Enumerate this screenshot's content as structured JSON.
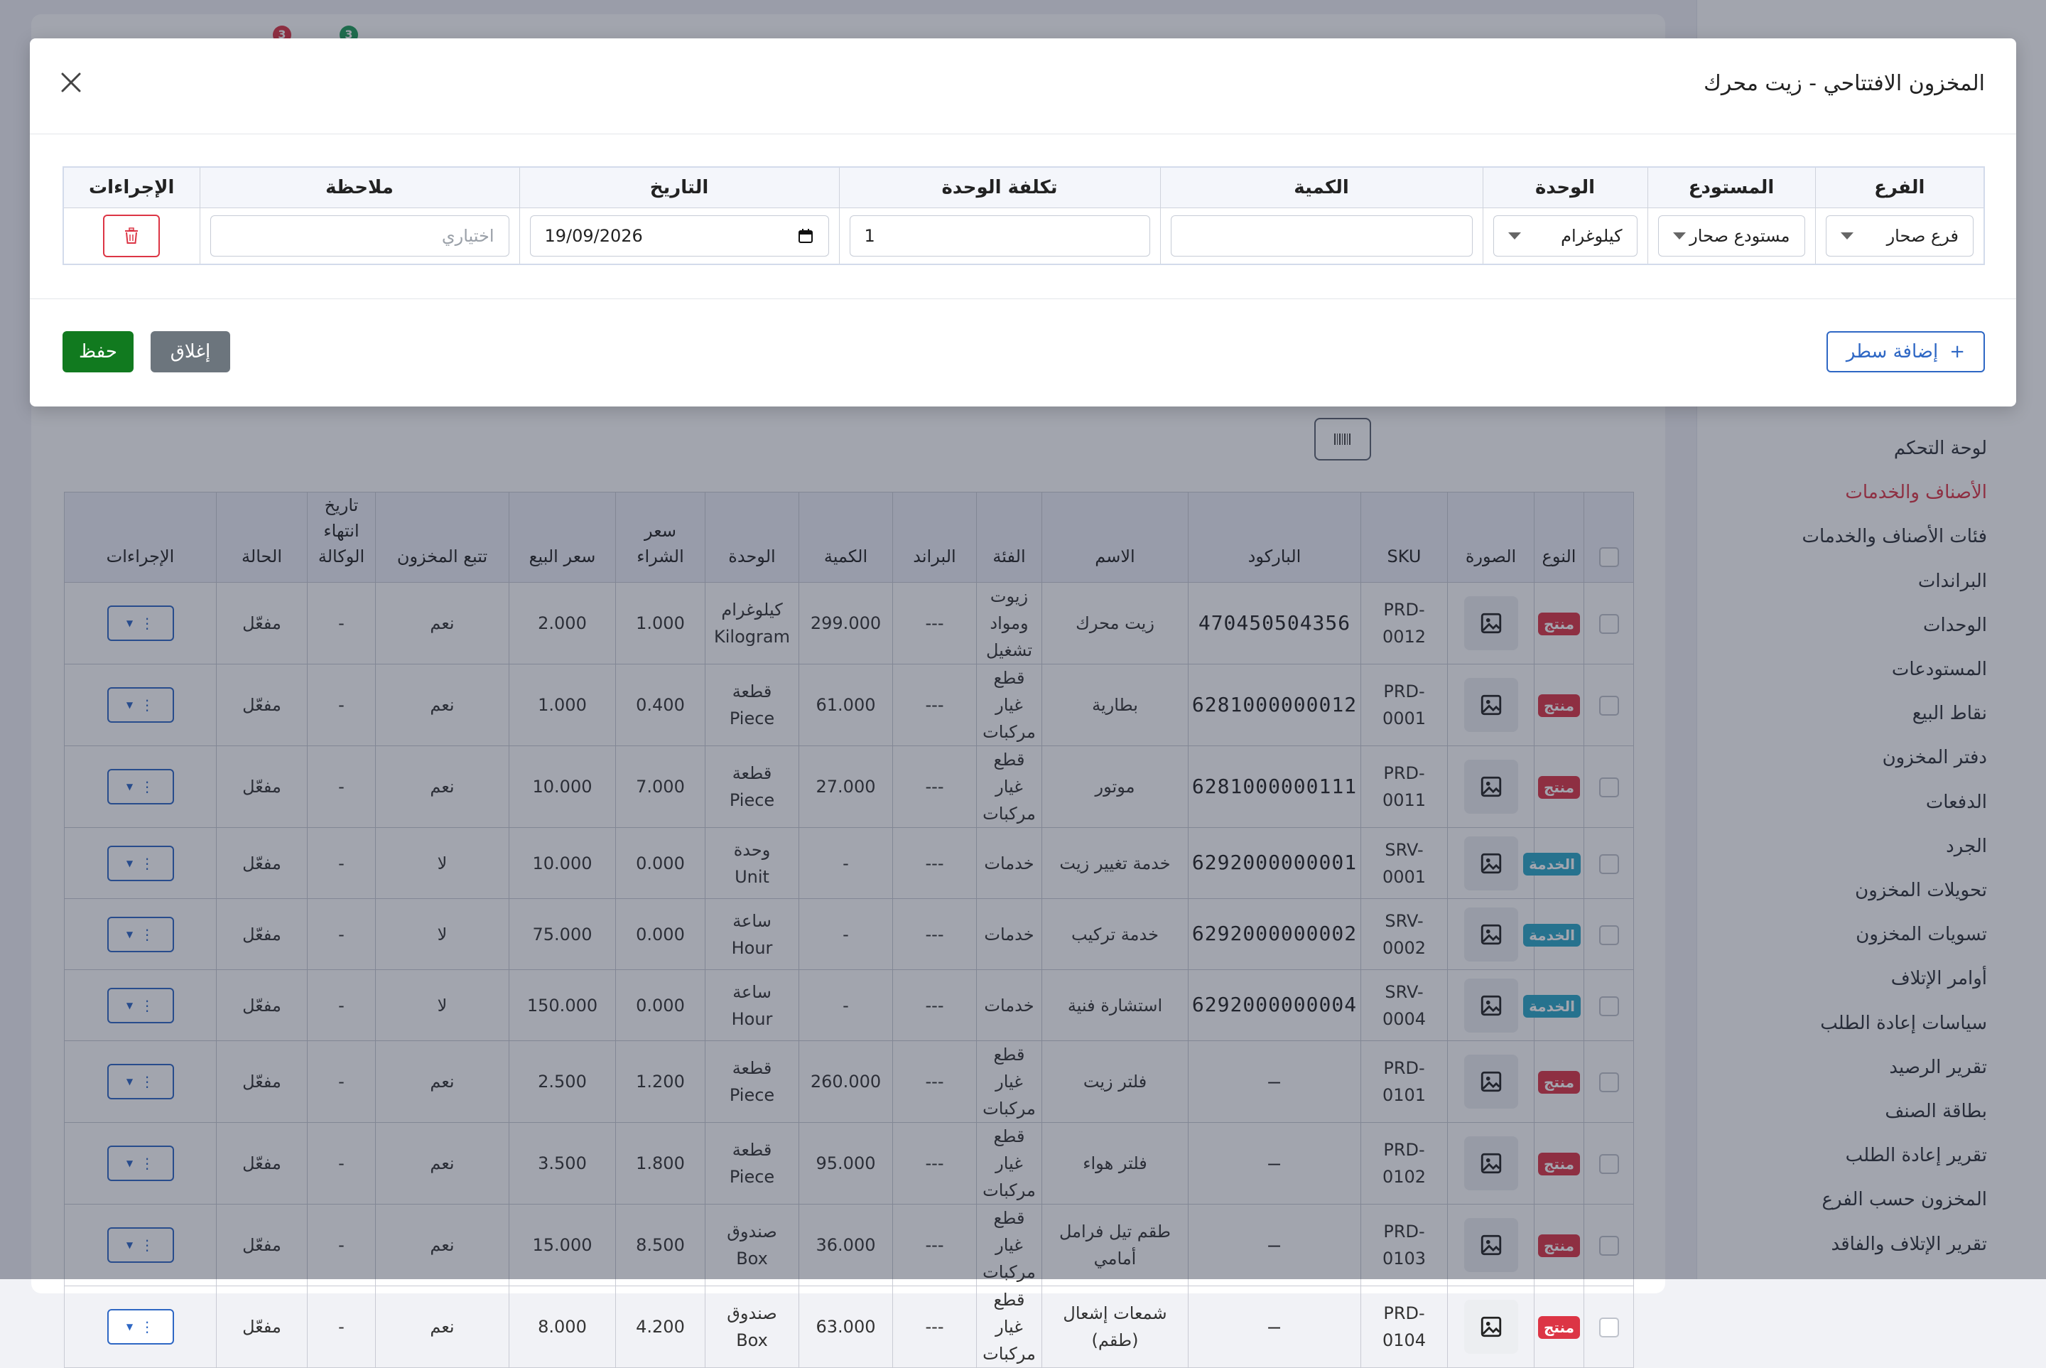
{
  "header": {
    "badge_red": "3",
    "badge_green": "3"
  },
  "sidebar": {
    "items": [
      {
        "label": "لوحة التحكم",
        "active": false
      },
      {
        "label": "الأصناف والخدمات",
        "active": true
      },
      {
        "label": "فئات الأصناف والخدمات",
        "active": false
      },
      {
        "label": "البراندات",
        "active": false
      },
      {
        "label": "الوحدات",
        "active": false
      },
      {
        "label": "المستودعات",
        "active": false
      },
      {
        "label": "نقاط البيع",
        "active": false
      },
      {
        "label": "دفتر المخزون",
        "active": false
      },
      {
        "label": "الدفعات",
        "active": false
      },
      {
        "label": "الجرد",
        "active": false
      },
      {
        "label": "تحويلات المخزون",
        "active": false
      },
      {
        "label": "تسويات المخزون",
        "active": false
      },
      {
        "label": "أوامر الإتلاف",
        "active": false
      },
      {
        "label": "سياسات إعادة الطلب",
        "active": false
      },
      {
        "label": "تقرير الرصيد",
        "active": false
      },
      {
        "label": "بطاقة الصنف",
        "active": false
      },
      {
        "label": "تقرير إعادة الطلب",
        "active": false
      },
      {
        "label": "المخزون حسب الفرع",
        "active": false
      },
      {
        "label": "تقرير الإتلاف والفاقد",
        "active": false
      }
    ]
  },
  "products_table": {
    "headers": {
      "type": "النوع",
      "image": "الصورة",
      "sku": "SKU",
      "barcode": "الباركود",
      "name": "الاسم",
      "category": "الفئة",
      "brand": "البراند",
      "quantity": "الكمية",
      "unit": "الوحدة",
      "purchase_price": "سعر الشراء",
      "sale_price": "سعر البيع",
      "stock_tracking": "تتبع المخزون",
      "agency_expiry": "تاريخ انتهاء الوكالة",
      "status": "الحالة",
      "actions": "الإجراءات"
    },
    "rows": [
      {
        "type": "منتج",
        "kind": "product",
        "sku": "PRD-0012",
        "barcode": "470450504356",
        "name": "زيت محرك",
        "category": "زيوت ومواد تشغيل",
        "brand": "---",
        "quantity": "299.000",
        "unit": "كيلوغرام",
        "unit_en": "Kilogram",
        "purchase": "1.000",
        "sale": "2.000",
        "tracking": "نعم",
        "expiry": "-",
        "status": "مفعّل"
      },
      {
        "type": "منتج",
        "kind": "product",
        "sku": "PRD-0001",
        "barcode": "6281000000012",
        "name": "بطارية",
        "category": "قطع غيار مركبات",
        "brand": "---",
        "quantity": "61.000",
        "unit": "قطعة",
        "unit_en": "Piece",
        "purchase": "0.400",
        "sale": "1.000",
        "tracking": "نعم",
        "expiry": "-",
        "status": "مفعّل"
      },
      {
        "type": "منتج",
        "kind": "product",
        "sku": "PRD-0011",
        "barcode": "6281000000111",
        "name": "موتور",
        "category": "قطع غيار مركبات",
        "brand": "---",
        "quantity": "27.000",
        "unit": "قطعة",
        "unit_en": "Piece",
        "purchase": "7.000",
        "sale": "10.000",
        "tracking": "نعم",
        "expiry": "-",
        "status": "مفعّل"
      },
      {
        "type": "الخدمة",
        "kind": "service",
        "sku": "SRV-0001",
        "barcode": "6292000000001",
        "name": "خدمة تغيير زيت",
        "category": "خدمات",
        "brand": "---",
        "quantity": "-",
        "unit": "وحدة",
        "unit_en": "Unit",
        "purchase": "0.000",
        "sale": "10.000",
        "tracking": "لا",
        "expiry": "-",
        "status": "مفعّل"
      },
      {
        "type": "الخدمة",
        "kind": "service",
        "sku": "SRV-0002",
        "barcode": "6292000000002",
        "name": "خدمة تركيب",
        "category": "خدمات",
        "brand": "---",
        "quantity": "-",
        "unit": "ساعة",
        "unit_en": "Hour",
        "purchase": "0.000",
        "sale": "75.000",
        "tracking": "لا",
        "expiry": "-",
        "status": "مفعّل"
      },
      {
        "type": "الخدمة",
        "kind": "service",
        "sku": "SRV-0004",
        "barcode": "6292000000004",
        "name": "استشارة فنية",
        "category": "خدمات",
        "brand": "---",
        "quantity": "-",
        "unit": "ساعة",
        "unit_en": "Hour",
        "purchase": "0.000",
        "sale": "150.000",
        "tracking": "لا",
        "expiry": "-",
        "status": "مفعّل"
      },
      {
        "type": "منتج",
        "kind": "product",
        "sku": "PRD-0101",
        "barcode": "—",
        "name": "فلتر زيت",
        "category": "قطع غيار مركبات",
        "brand": "---",
        "quantity": "260.000",
        "unit": "قطعة",
        "unit_en": "Piece",
        "purchase": "1.200",
        "sale": "2.500",
        "tracking": "نعم",
        "expiry": "-",
        "status": "مفعّل"
      },
      {
        "type": "منتج",
        "kind": "product",
        "sku": "PRD-0102",
        "barcode": "—",
        "name": "فلتر هواء",
        "category": "قطع غيار مركبات",
        "brand": "---",
        "quantity": "95.000",
        "unit": "قطعة",
        "unit_en": "Piece",
        "purchase": "1.800",
        "sale": "3.500",
        "tracking": "نعم",
        "expiry": "-",
        "status": "مفعّل"
      },
      {
        "type": "منتج",
        "kind": "product",
        "sku": "PRD-0103",
        "barcode": "—",
        "name": "طقم تيل فرامل أمامي",
        "category": "قطع غيار مركبات",
        "brand": "---",
        "quantity": "36.000",
        "unit": "صندوق",
        "unit_en": "Box",
        "purchase": "8.500",
        "sale": "15.000",
        "tracking": "نعم",
        "expiry": "-",
        "status": "مفعّل"
      },
      {
        "type": "منتج",
        "kind": "product",
        "sku": "PRD-0104",
        "barcode": "—",
        "name": "شمعات إشعال (طقم)",
        "category": "قطع غيار مركبات",
        "brand": "---",
        "quantity": "63.000",
        "unit": "صندوق",
        "unit_en": "Box",
        "purchase": "4.200",
        "sale": "8.000",
        "tracking": "نعم",
        "expiry": "-",
        "status": "مفعّل"
      }
    ]
  },
  "modal": {
    "title": "المخزون الافتتاحي - زيت محرك",
    "headers": {
      "branch": "الفرع",
      "warehouse": "المستودع",
      "unit": "الوحدة",
      "quantity": "الكمية",
      "unit_cost": "تكلفة الوحدة",
      "date": "التاريخ",
      "note": "ملاحظة",
      "actions": "الإجراءات"
    },
    "row": {
      "branch": "فرع صحار",
      "warehouse": "مستودع صحار",
      "unit": "كيلوغرام",
      "quantity": "",
      "unit_cost": "1",
      "date": "19/09/2026",
      "note_placeholder": "اختياري"
    },
    "add_row_label": "إضافة سطر",
    "add_row_icon": "+",
    "close_label": "إغلاق",
    "save_label": "حفظ"
  },
  "colors": {
    "accent_blue": "#2e67c4",
    "danger_red": "#dc3545",
    "save_green": "#117a1f",
    "service_badge": "#2aa7c9",
    "close_gray": "#6c757d"
  }
}
